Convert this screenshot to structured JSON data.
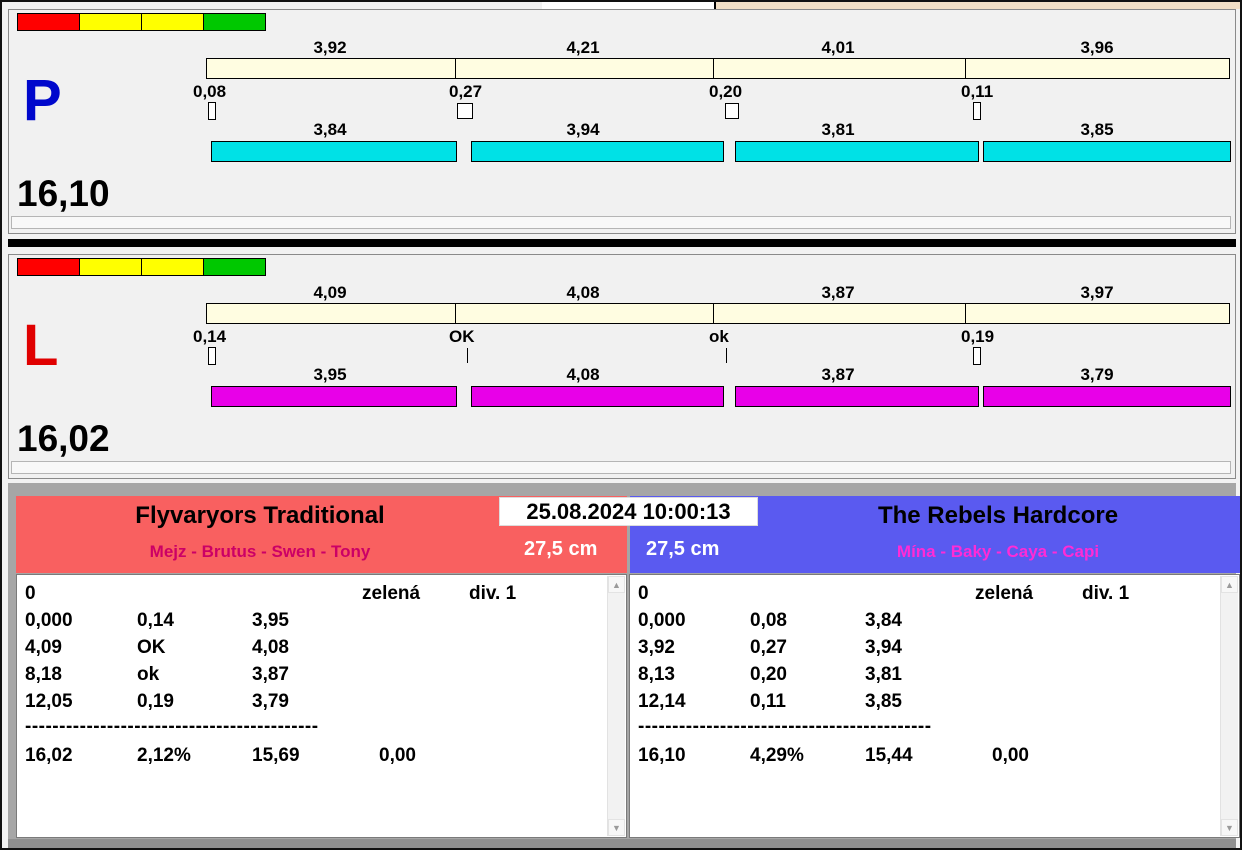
{
  "window": {
    "datetime": "25.08.2024 10:00:13"
  },
  "icons": {
    "scroll_up": "▲",
    "scroll_down": "▼"
  },
  "colors": {
    "lane_p_letter": "#0008cc",
    "lane_l_letter": "#e00000",
    "lane_p_run_bar": "#00e1e6",
    "lane_l_run_bar": "#e800e8",
    "split_bar": "#fffde1",
    "traffic_red": "#ff0000",
    "traffic_yellow": "#ffff00",
    "traffic_green": "#00c800",
    "team_left_header": "#f96060",
    "team_right_header": "#5a5af0"
  },
  "lanes": [
    {
      "letter": "P",
      "total": "16,10",
      "split_times": [
        "3,92",
        "4,21",
        "4,01",
        "3,96"
      ],
      "change_times": [
        "0,08",
        "0,27",
        "0,20",
        "0,11"
      ],
      "run_times": [
        "3,84",
        "3,94",
        "3,81",
        "3,85"
      ]
    },
    {
      "letter": "L",
      "total": "16,02",
      "split_times": [
        "4,09",
        "4,08",
        "3,87",
        "3,97"
      ],
      "change_times": [
        "0,14",
        "OK",
        "ok",
        "0,19"
      ],
      "run_times": [
        "3,95",
        "4,08",
        "3,87",
        "3,79"
      ]
    }
  ],
  "teams": [
    {
      "name": "Flyvaryors Traditional",
      "members": "Mejz - Brutus - Swen - Tony",
      "jump_height": "27,5 cm",
      "start_value": "0",
      "status": "zelená",
      "division": "div. 1",
      "rows": [
        [
          "0,000",
          "0,14",
          "3,95"
        ],
        [
          "4,09",
          "OK",
          "4,08"
        ],
        [
          "8,18",
          "ok",
          "3,87"
        ],
        [
          "12,05",
          "0,19",
          "3,79"
        ]
      ],
      "separator": "-------------------------------------------",
      "totals": [
        "16,02",
        "2,12%",
        "15,69",
        "0,00"
      ]
    },
    {
      "name": "The Rebels Hardcore",
      "members": "Mína - Baky - Caya - Capi",
      "jump_height": "27,5 cm",
      "start_value": "0",
      "status": "zelená",
      "division": "div. 1",
      "rows": [
        [
          "0,000",
          "0,08",
          "3,84"
        ],
        [
          "3,92",
          "0,27",
          "3,94"
        ],
        [
          "8,13",
          "0,20",
          "3,81"
        ],
        [
          "12,14",
          "0,11",
          "3,85"
        ]
      ],
      "separator": "-------------------------------------------",
      "totals": [
        "16,10",
        "4,29%",
        "15,44",
        "0,00"
      ]
    }
  ]
}
